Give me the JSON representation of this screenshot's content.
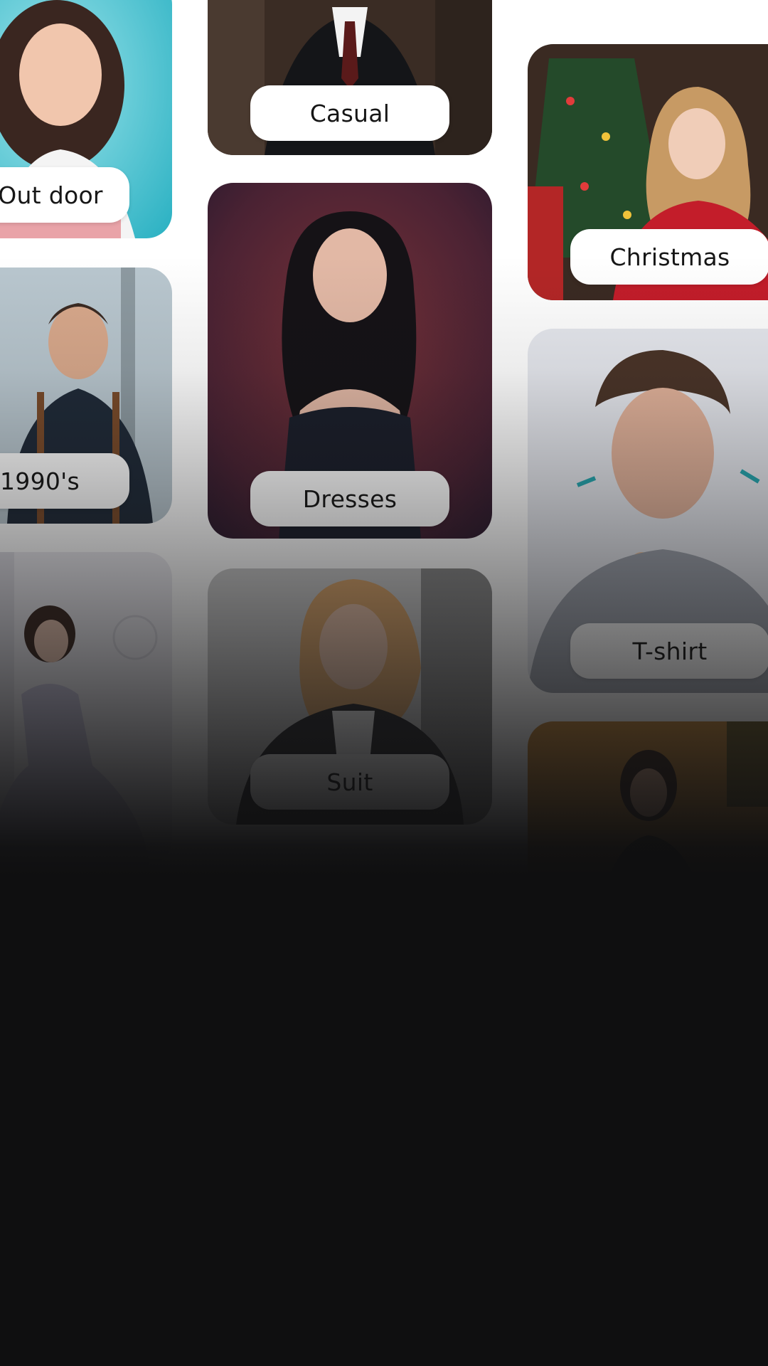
{
  "categories": [
    {
      "key": "outdoor",
      "label": "Out door"
    },
    {
      "key": "casual",
      "label": "Casual"
    },
    {
      "key": "christmas",
      "label": "Christmas"
    },
    {
      "key": "nineties",
      "label": "1990's"
    },
    {
      "key": "dresses",
      "label": "Dresses"
    },
    {
      "key": "tshirt",
      "label": "T-shirt"
    },
    {
      "key": "gown",
      "label": ""
    },
    {
      "key": "suit",
      "label": "Suit"
    },
    {
      "key": "autumn",
      "label": ""
    }
  ],
  "colors": {
    "background_dark": "#0f0f10",
    "pill_background": "#ffffff",
    "pill_text": "#161616"
  }
}
